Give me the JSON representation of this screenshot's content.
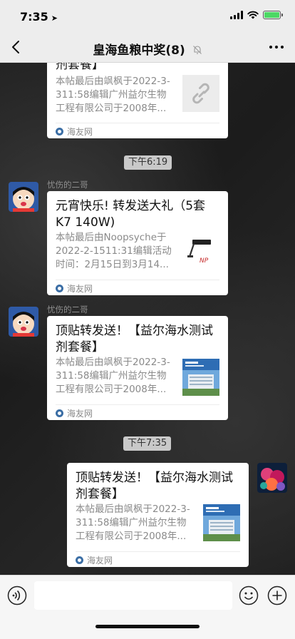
{
  "status": {
    "time": "7:35",
    "battery_color": "#4cd964"
  },
  "nav": {
    "title": "皇海鱼粮中奖(8)"
  },
  "messages": [
    {
      "title_tail": "剂套餐】",
      "desc": "本帖最后由飒枫于2022-3-311:58编辑广州益尔生物工程有限公司于2008年...",
      "thumb": "link-icon",
      "source": "海友网"
    },
    {
      "time": "下午6:19"
    },
    {
      "nickname": "忧伤的二哥",
      "title": "元宵快乐! 转发送大礼（5套K7 140W)",
      "desc": "本帖最后由Noopsyche于2022-2-1511:31编辑活动时间：2月15日到3月14...",
      "thumb": "light-product",
      "source": "海友网"
    },
    {
      "nickname": "忧伤的二哥",
      "title": "顶贴转发送！【益尔海水测试剂套餐】",
      "desc": "本帖最后由飒枫于2022-3-311:58编辑广州益尔生物工程有限公司于2008年...",
      "thumb": "building-photo",
      "source": "海友网"
    },
    {
      "time": "下午7:35"
    },
    {
      "title": "顶贴转发送！【益尔海水测试剂套餐】",
      "desc": "本帖最后由飒枫于2022-3-311:58编辑广州益尔生物工程有限公司于2008年...",
      "thumb": "building-photo",
      "source": "海友网"
    }
  ]
}
